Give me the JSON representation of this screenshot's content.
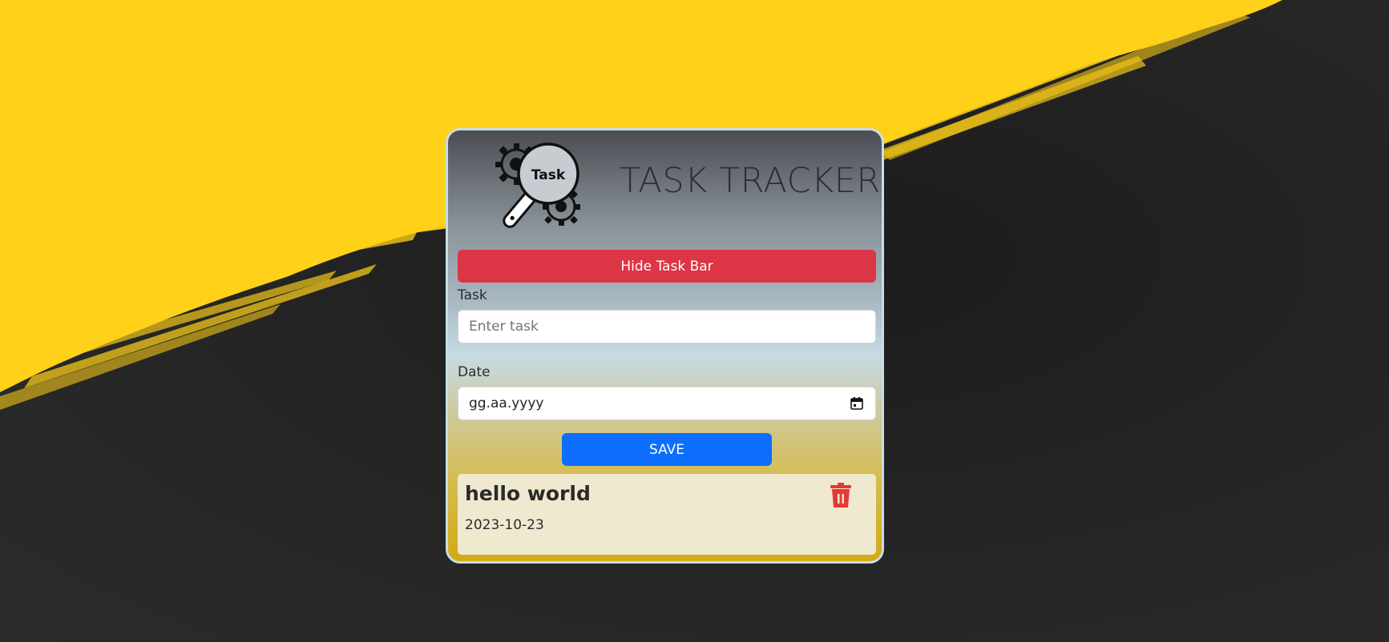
{
  "app": {
    "title": "TASK TRACKER",
    "logo_text": "Task"
  },
  "toggle_button": {
    "label": "Hide Task Bar"
  },
  "form": {
    "task_label": "Task",
    "task_placeholder": "Enter task",
    "task_value": "",
    "date_label": "Date",
    "date_value": "gg.aa.yyyy",
    "save_label": "SAVE"
  },
  "tasks": [
    {
      "text": "hello world",
      "date": "2023-10-23"
    }
  ],
  "icons": {
    "logo": "gear-magnifier-icon",
    "date_picker": "calendar-icon",
    "delete": "trash-icon"
  },
  "colors": {
    "danger": "#dc3545",
    "primary": "#0d6efd",
    "background_accent": "#ffd119",
    "delete_icon": "#e53935"
  }
}
